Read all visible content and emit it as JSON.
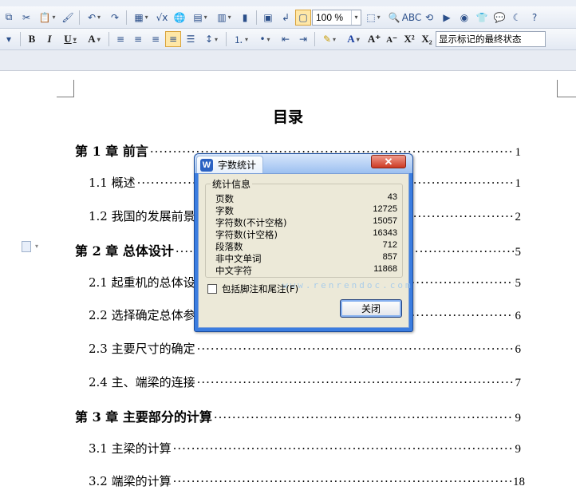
{
  "toolbar": {
    "zoom_value": "100 %",
    "review_state": "显示标记的最终状态"
  },
  "document": {
    "title": "目录",
    "toc": [
      {
        "label": "第 1 章  前言",
        "page": "1",
        "level": 1
      },
      {
        "label": "1.1  概述",
        "page": "1",
        "level": 2
      },
      {
        "label": "1.2 我国的发展前景",
        "page": "2",
        "level": 2
      },
      {
        "label": "第 2 章  总体设计",
        "page": "5",
        "level": 1
      },
      {
        "label": "2.1 起重机的总体设计",
        "page": "5",
        "level": 2
      },
      {
        "label": "2.2 选择确定总体参数",
        "page": "6",
        "level": 2
      },
      {
        "label": "2.3 主要尺寸的确定",
        "page": "6",
        "level": 2
      },
      {
        "label": "2.4  主、端梁的连接",
        "page": "7",
        "level": 2
      },
      {
        "label": "第 3 章  主要部分的计算",
        "page": "9",
        "level": 1
      },
      {
        "label": "3.1  主梁的计算",
        "page": "9",
        "level": 2
      },
      {
        "label": "3.2  端梁的计算",
        "page": "18",
        "level": 2
      }
    ]
  },
  "dialog": {
    "title": "字数统计",
    "close_symbol": "✕",
    "group_label": "统计信息",
    "stats": [
      {
        "label": "页数",
        "value": "43"
      },
      {
        "label": "字数",
        "value": "12725"
      },
      {
        "label": "字符数(不计空格)",
        "value": "15057"
      },
      {
        "label": "字符数(计空格)",
        "value": "16343"
      },
      {
        "label": "段落数",
        "value": "712"
      },
      {
        "label": "非中文单词",
        "value": "857"
      },
      {
        "label": "中文字符",
        "value": "11868"
      }
    ],
    "include_footnotes_label": "包括脚注和尾注(F)",
    "close_button_label": "关闭",
    "watermark": "www.renrendoc.com"
  }
}
